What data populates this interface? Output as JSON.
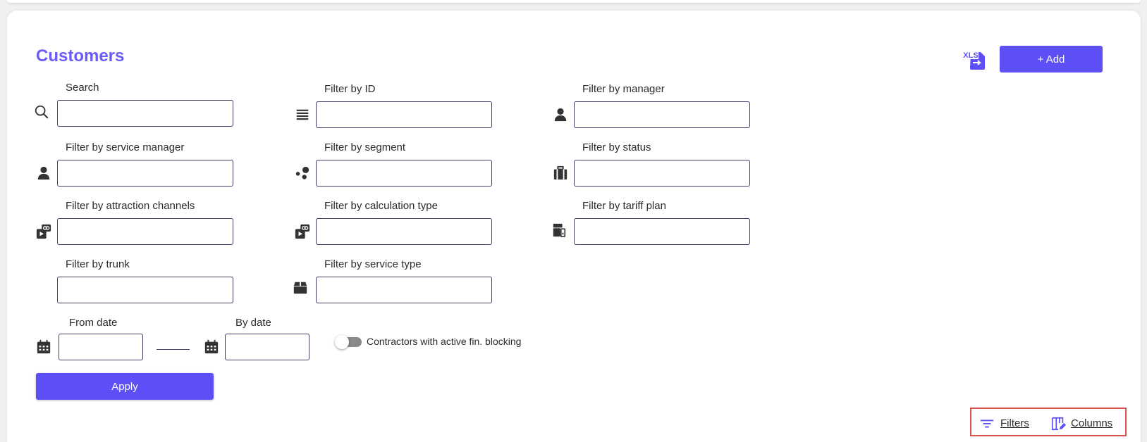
{
  "page": {
    "title": "Customers"
  },
  "header": {
    "xls_label": "XLS",
    "add_label": "+ Add"
  },
  "filters": {
    "search": {
      "label": "Search",
      "value": "",
      "placeholder": ""
    },
    "id": {
      "label": "Filter by ID",
      "value": ""
    },
    "manager": {
      "label": "Filter by manager",
      "value": ""
    },
    "service_manager": {
      "label": "Filter by service manager",
      "value": ""
    },
    "segment": {
      "label": "Filter by segment",
      "value": ""
    },
    "status": {
      "label": "Filter by status",
      "value": ""
    },
    "attraction_channels": {
      "label": "Filter by attraction channels",
      "value": ""
    },
    "calculation_type": {
      "label": "Filter by calculation type",
      "value": ""
    },
    "tariff_plan": {
      "label": "Filter by tariff plan",
      "value": ""
    },
    "trunk": {
      "label": "Filter by trunk",
      "value": ""
    },
    "service_type": {
      "label": "Filter by service type",
      "value": ""
    },
    "from_date": {
      "label": "From date",
      "value": ""
    },
    "by_date": {
      "label": "By date",
      "value": ""
    },
    "fin_blocking": {
      "label": "Contractors with active fin. blocking",
      "checked": false
    }
  },
  "actions": {
    "apply_label": "Apply"
  },
  "footer": {
    "filters_label": "Filters",
    "columns_label": "Columns"
  },
  "colors": {
    "accent": "#5b4ff5",
    "title": "#6a5cf6",
    "highlight": "#d9534f"
  }
}
